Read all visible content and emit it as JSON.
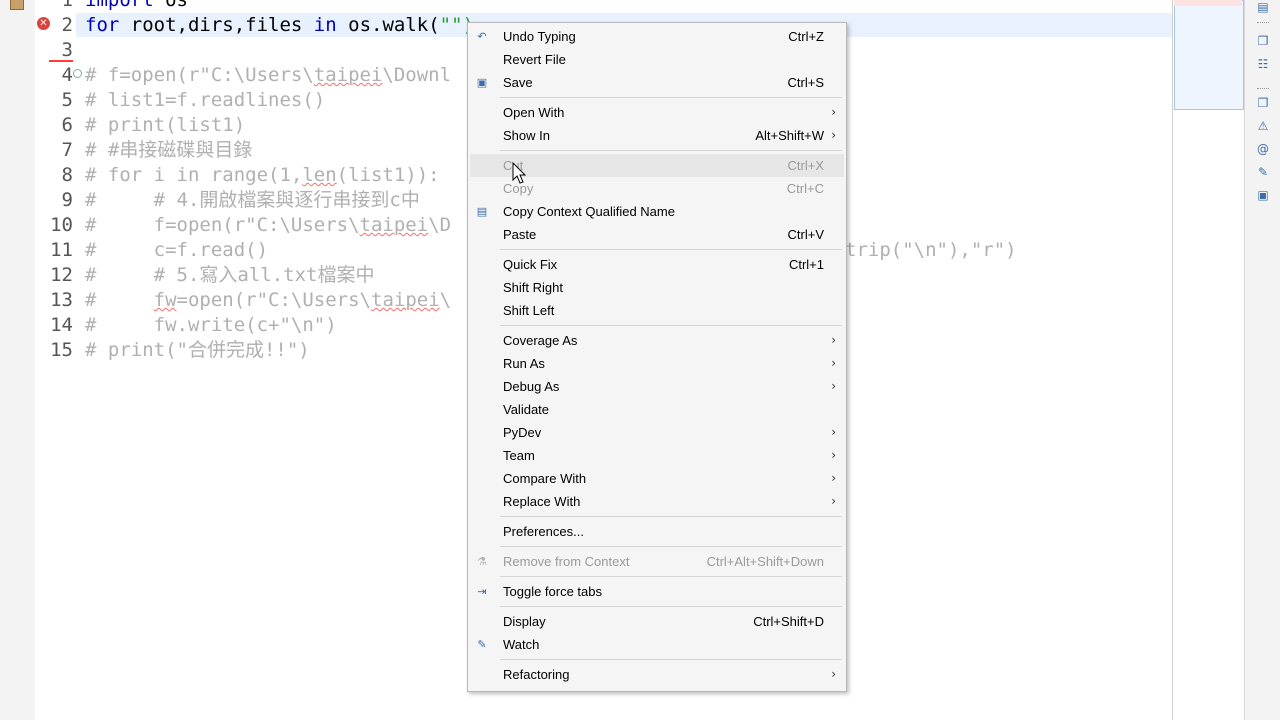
{
  "editor": {
    "lines": [
      {
        "num": "1",
        "parts": [
          {
            "t": "import",
            "c": "kw"
          },
          {
            "t": " os",
            "c": "plain"
          }
        ]
      },
      {
        "num": "2",
        "parts": [
          {
            "t": "for",
            "c": "kw"
          },
          {
            "t": " root,dirs,files ",
            "c": "plain"
          },
          {
            "t": "in",
            "c": "kw"
          },
          {
            "t": " os.walk(",
            "c": "plain"
          },
          {
            "t": "\"\")",
            "c": "caret-box"
          }
        ]
      },
      {
        "num": "3",
        "parts": []
      },
      {
        "num": "4",
        "parts": [
          {
            "t": "# f=open(r\"C:\\Users\\",
            "c": "comment"
          },
          {
            "t": "taipei",
            "c": "comment squiggle"
          },
          {
            "t": "\\Downl",
            "c": "comment"
          }
        ]
      },
      {
        "num": "5",
        "parts": [
          {
            "t": "# list1=f.readlines()",
            "c": "comment"
          }
        ]
      },
      {
        "num": "6",
        "parts": [
          {
            "t": "# print(list1)",
            "c": "comment"
          }
        ]
      },
      {
        "num": "7",
        "parts": [
          {
            "t": "# #串接磁碟與目錄",
            "c": "comment"
          }
        ]
      },
      {
        "num": "8",
        "parts": [
          {
            "t": "# for i in range(1,",
            "c": "comment"
          },
          {
            "t": "len",
            "c": "comment squiggle"
          },
          {
            "t": "(list1)):",
            "c": "comment"
          }
        ]
      },
      {
        "num": "9",
        "parts": [
          {
            "t": "#     # 4.開啟檔案與逐行串接到c中",
            "c": "comment"
          }
        ]
      },
      {
        "num": "10",
        "parts": [
          {
            "t": "#     f=open(r\"C:\\Users\\",
            "c": "comment"
          },
          {
            "t": "taipei",
            "c": "comment squiggle"
          },
          {
            "t": "\\D",
            "c": "comment"
          }
        ]
      },
      {
        "num": "11",
        "parts": [
          {
            "t": "#     c=f.read()",
            "c": "comment"
          }
        ]
      },
      {
        "num": "12",
        "parts": [
          {
            "t": "#     # 5.寫入all.txt檔案中",
            "c": "comment"
          }
        ]
      },
      {
        "num": "13",
        "parts": [
          {
            "t": "#     ",
            "c": "comment"
          },
          {
            "t": "fw",
            "c": "comment squiggle"
          },
          {
            "t": "=open(r\"C:\\Users\\",
            "c": "comment"
          },
          {
            "t": "taipei",
            "c": "comment squiggle"
          },
          {
            "t": "\\",
            "c": "comment"
          }
        ]
      },
      {
        "num": "14",
        "parts": [
          {
            "t": "#     fw.write(c+\"\\n\")",
            "c": "comment"
          }
        ]
      },
      {
        "num": "15",
        "parts": [
          {
            "t": "# print(\"合併完成!!\")",
            "c": "comment"
          }
        ]
      }
    ],
    "overflow_line10": "trip(\"\\n\"),\"r\")",
    "overflow_line13": ")"
  },
  "context_menu": {
    "items": [
      {
        "type": "item",
        "label": "Undo Typing",
        "shortcut": "Ctrl+Z",
        "icon": "undo-icon",
        "glyph": "↶"
      },
      {
        "type": "item",
        "label": "Revert File",
        "shortcut": ""
      },
      {
        "type": "item",
        "label": "Save",
        "shortcut": "Ctrl+S",
        "icon": "save-icon",
        "glyph": "▣"
      },
      {
        "type": "sep"
      },
      {
        "type": "item",
        "label": "Open With",
        "submenu": true
      },
      {
        "type": "item",
        "label": "Show In",
        "shortcut": "Alt+Shift+W",
        "submenu": true
      },
      {
        "type": "sep"
      },
      {
        "type": "item",
        "label": "Cut",
        "shortcut": "Ctrl+X",
        "disabled": true,
        "hover": true
      },
      {
        "type": "item",
        "label": "Copy",
        "shortcut": "Ctrl+C",
        "disabled": true
      },
      {
        "type": "item",
        "label": "Copy Context Qualified Name",
        "icon": "copy-qualified-icon",
        "glyph": "▤"
      },
      {
        "type": "item",
        "label": "Paste",
        "shortcut": "Ctrl+V"
      },
      {
        "type": "sep"
      },
      {
        "type": "item",
        "label": "Quick Fix",
        "shortcut": "Ctrl+1"
      },
      {
        "type": "item",
        "label": "Shift Right"
      },
      {
        "type": "item",
        "label": "Shift Left"
      },
      {
        "type": "sep"
      },
      {
        "type": "item",
        "label": "Coverage As",
        "submenu": true
      },
      {
        "type": "item",
        "label": "Run As",
        "submenu": true
      },
      {
        "type": "item",
        "label": "Debug As",
        "submenu": true
      },
      {
        "type": "item",
        "label": "Validate"
      },
      {
        "type": "item",
        "label": "PyDev",
        "submenu": true
      },
      {
        "type": "item",
        "label": "Team",
        "submenu": true
      },
      {
        "type": "item",
        "label": "Compare With",
        "submenu": true
      },
      {
        "type": "item",
        "label": "Replace With",
        "submenu": true
      },
      {
        "type": "sep"
      },
      {
        "type": "item",
        "label": "Preferences..."
      },
      {
        "type": "sep"
      },
      {
        "type": "item",
        "label": "Remove from Context",
        "shortcut": "Ctrl+Alt+Shift+Down",
        "disabled": true,
        "icon": "remove-context-icon",
        "glyph": "⚗"
      },
      {
        "type": "sep"
      },
      {
        "type": "item",
        "label": "Toggle force tabs",
        "icon": "toggle-tabs-icon",
        "glyph": "⇥"
      },
      {
        "type": "sep"
      },
      {
        "type": "item",
        "label": "Display",
        "shortcut": "Ctrl+Shift+D"
      },
      {
        "type": "item",
        "label": "Watch",
        "icon": "watch-icon",
        "glyph": "✎"
      },
      {
        "type": "sep"
      },
      {
        "type": "item",
        "label": "Refactoring",
        "submenu": true
      }
    ]
  },
  "colors": {
    "keyword": "#0000c0",
    "comment": "#b0b0b0",
    "current_line": "#e8f2fe",
    "error": "#d9453b"
  }
}
